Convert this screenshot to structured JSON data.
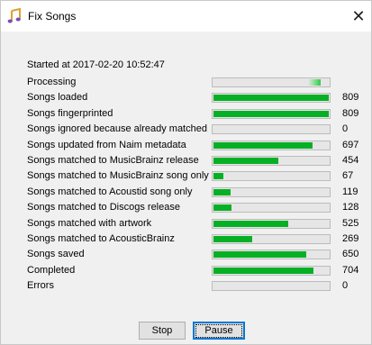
{
  "window": {
    "title": "Fix Songs",
    "icon": "music-note-icon",
    "close_glyph": "✕"
  },
  "started": "Started at 2017-02-20 10:52:47",
  "colors": {
    "progress": "#06b025",
    "window_bg": "#f0f0f0"
  },
  "progress_max": 809,
  "rows": [
    {
      "label": "Processing",
      "count": "",
      "value": null,
      "indeterminate": true
    },
    {
      "label": "Songs loaded",
      "count": "809",
      "value": 809
    },
    {
      "label": "Songs fingerprinted",
      "count": "809",
      "value": 809
    },
    {
      "label": "Songs ignored because already matched",
      "count": "0",
      "value": 0
    },
    {
      "label": "Songs updated from Naim metadata",
      "count": "697",
      "value": 697
    },
    {
      "label": "Songs matched to MusicBrainz release",
      "count": "454",
      "value": 454
    },
    {
      "label": "Songs matched to MusicBrainz song only",
      "count": "67",
      "value": 67
    },
    {
      "label": "Songs matched to Acoustid song only",
      "count": "119",
      "value": 119
    },
    {
      "label": "Songs matched to Discogs release",
      "count": "128",
      "value": 128
    },
    {
      "label": "Songs matched with artwork",
      "count": "525",
      "value": 525
    },
    {
      "label": "Songs matched to AcousticBrainz",
      "count": "269",
      "value": 269
    },
    {
      "label": "Songs saved",
      "count": "650",
      "value": 650
    },
    {
      "label": "Completed",
      "count": "704",
      "value": 704
    },
    {
      "label": "Errors",
      "count": "0",
      "value": 0
    }
  ],
  "buttons": {
    "stop": "Stop",
    "pause": "Pause"
  }
}
